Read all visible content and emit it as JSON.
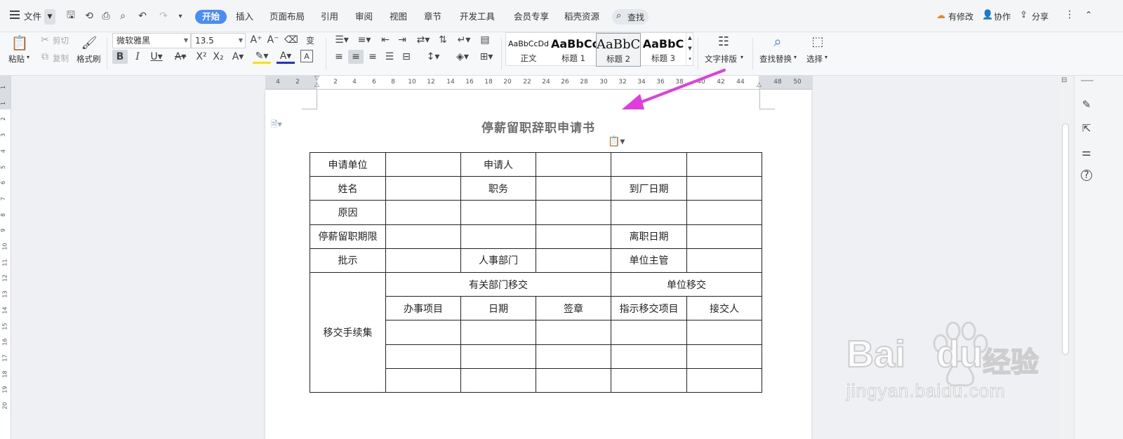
{
  "menubar": {
    "file_label": "文件",
    "tabs": [
      "开始",
      "插入",
      "页面布局",
      "引用",
      "审阅",
      "视图",
      "章节",
      "开发工具",
      "会员专享",
      "稻壳资源"
    ],
    "search_label": "查找",
    "modified_label": "有修改",
    "collab_label": "协作",
    "share_label": "分享"
  },
  "ribbon": {
    "paste": "粘贴",
    "cut": "剪切",
    "copy": "复制",
    "format_painter": "格式刷",
    "font_name": "微软雅黑",
    "font_size": "13.5",
    "styles": [
      {
        "preview": "AaBbCcDd",
        "label": "正文"
      },
      {
        "preview": "AaBbCc",
        "label": "标题 1"
      },
      {
        "preview": "AaBbC",
        "label": "标题 2"
      },
      {
        "preview": "AaBbC",
        "label": "标题 3"
      }
    ],
    "text_layout": "文字排版",
    "find_replace": "查找替换",
    "select": "选择"
  },
  "ruler_h": [
    "4",
    "2",
    "2",
    "4",
    "6",
    "8",
    "10",
    "12",
    "14",
    "16",
    "18",
    "20",
    "22",
    "24",
    "26",
    "28",
    "30",
    "32",
    "34",
    "36",
    "38",
    "40",
    "42",
    "44",
    "48",
    "50"
  ],
  "ruler_v": [
    "1",
    "1",
    "2",
    "3",
    "4",
    "5",
    "6",
    "7",
    "8",
    "9",
    "10",
    "11",
    "12",
    "13",
    "14",
    "15",
    "16",
    "17",
    "18",
    "19",
    "20"
  ],
  "document": {
    "title": "停薪留职辞职申请书",
    "table": {
      "r1": [
        "申请单位",
        "",
        "申请人",
        "",
        "",
        ""
      ],
      "r2": [
        "姓名",
        "",
        "职务",
        "",
        "到厂日期",
        ""
      ],
      "r3": [
        "原因",
        "",
        "",
        "",
        "",
        ""
      ],
      "r4": [
        "停薪留职期限",
        "",
        "",
        "",
        "离职日期",
        ""
      ],
      "r5": [
        "批示",
        "",
        "人事部门",
        "",
        "单位主管",
        ""
      ],
      "transfer_label": "移交手续集",
      "dept_transfer": "有关部门移交",
      "unit_transfer": "单位移交",
      "sub_headers": [
        "办事项目",
        "日期",
        "签章",
        "指示移交项目",
        "接交人"
      ]
    }
  },
  "watermark": {
    "brand": "Bai",
    "brand2": "du",
    "cn": "经验",
    "url": "jingyan.baidu.com"
  },
  "colors": {
    "accent": "#4a8df8",
    "arrow": "#e23cdc"
  }
}
